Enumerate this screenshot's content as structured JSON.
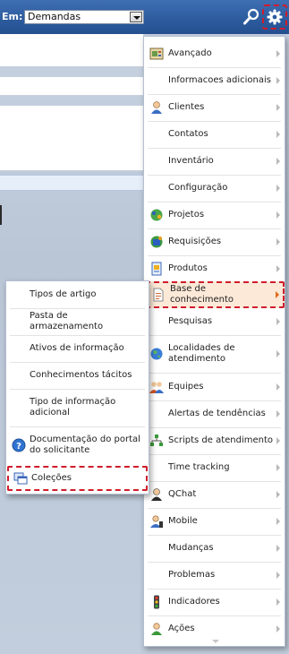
{
  "topbar": {
    "em_label": "Em:",
    "select_value": "Demandas"
  },
  "menu": {
    "items": [
      {
        "label": "Avançado",
        "icon": "advanced-icon"
      },
      {
        "label": "Informacoes adicionais",
        "icon": ""
      },
      {
        "label": "Clientes",
        "icon": "customer-icon"
      },
      {
        "label": "Contatos",
        "icon": ""
      },
      {
        "label": "Inventário",
        "icon": ""
      },
      {
        "label": "Configuração",
        "icon": ""
      },
      {
        "label": "Projetos",
        "icon": "projects-icon"
      },
      {
        "label": "Requisições",
        "icon": "requests-icon"
      },
      {
        "label": "Produtos",
        "icon": "products-icon"
      },
      {
        "label": "Base de conhecimento",
        "icon": "knowledge-base-icon"
      },
      {
        "label": "Pesquisas",
        "icon": ""
      },
      {
        "label": "Localidades de atendimento",
        "icon": "globe-icon"
      },
      {
        "label": "Equipes",
        "icon": "teams-icon"
      },
      {
        "label": "Alertas de tendências",
        "icon": ""
      },
      {
        "label": "Scripts de atendimento",
        "icon": "scripts-icon"
      },
      {
        "label": "Time tracking",
        "icon": ""
      },
      {
        "label": "QChat",
        "icon": "chat-icon"
      },
      {
        "label": "Mobile",
        "icon": "mobile-icon"
      },
      {
        "label": "Mudanças",
        "icon": ""
      },
      {
        "label": "Problemas",
        "icon": ""
      },
      {
        "label": "Indicadores",
        "icon": "traffic-light-icon"
      },
      {
        "label": "Ações",
        "icon": "actions-icon"
      }
    ]
  },
  "submenu": {
    "items": [
      {
        "label": "Tipos de artigo"
      },
      {
        "label": "Pasta de armazenamento"
      },
      {
        "label": "Ativos de informação"
      },
      {
        "label": "Conhecimentos tácitos"
      },
      {
        "label": "Tipo de informação adicional"
      },
      {
        "label": "Documentação do portal do solicitante",
        "icon": "help-icon"
      },
      {
        "label": "Coleções",
        "icon": "collections-icon"
      }
    ]
  },
  "colors": {
    "topbar": "#2d5c9f",
    "highlight_border": "#d01c2c",
    "highlight_fill": "#fce9d8",
    "submenu_arrow": "#e06a1a"
  }
}
